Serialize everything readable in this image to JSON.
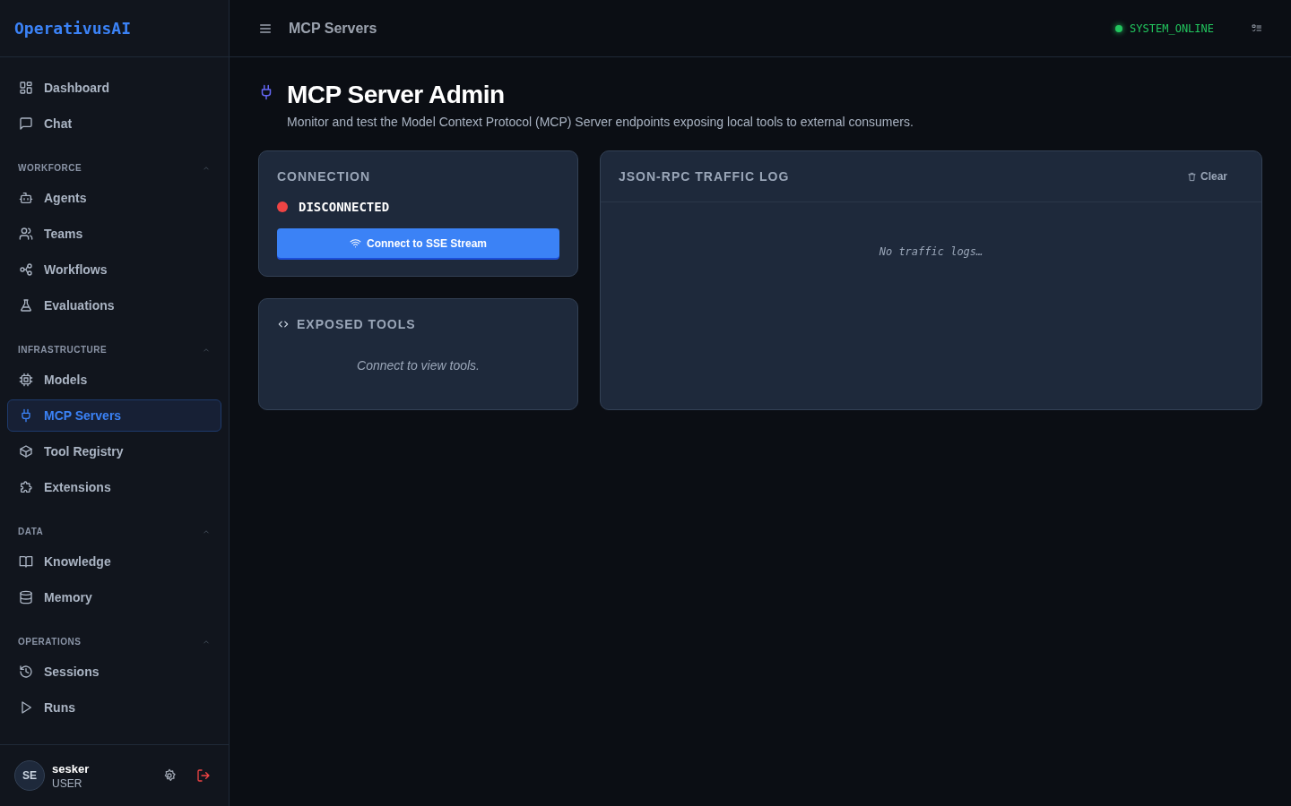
{
  "sidebar": {
    "logo": "OperativusAI",
    "top_items": [
      {
        "label": "Dashboard",
        "selected": false
      },
      {
        "label": "Chat",
        "selected": false
      }
    ],
    "sections": [
      {
        "title": "WORKFORCE",
        "expanded": true,
        "items": [
          {
            "label": "Agents",
            "selected": false
          },
          {
            "label": "Teams",
            "selected": false
          },
          {
            "label": "Workflows",
            "selected": false
          },
          {
            "label": "Evaluations",
            "selected": false
          }
        ]
      },
      {
        "title": "INFRASTRUCTURE",
        "expanded": true,
        "items": [
          {
            "label": "Models",
            "selected": false
          },
          {
            "label": "MCP Servers",
            "selected": true
          },
          {
            "label": "Tool Registry",
            "selected": false
          },
          {
            "label": "Extensions",
            "selected": false
          }
        ]
      },
      {
        "title": "DATA",
        "expanded": true,
        "items": [
          {
            "label": "Knowledge",
            "selected": false
          },
          {
            "label": "Memory",
            "selected": false
          }
        ]
      },
      {
        "title": "OPERATIONS",
        "expanded": true,
        "items": [
          {
            "label": "Sessions",
            "selected": false
          },
          {
            "label": "Runs",
            "selected": false
          }
        ]
      }
    ],
    "user": {
      "initials": "SE",
      "name": "sesker",
      "role": "USER"
    }
  },
  "header": {
    "title": "MCP Servers",
    "status": "SYSTEM_ONLINE"
  },
  "page": {
    "title": "MCP Server Admin",
    "subtitle": "Monitor and test the Model Context Protocol (MCP) Server endpoints exposing local tools to external consumers."
  },
  "connection": {
    "title": "CONNECTION",
    "status": "DISCONNECTED",
    "connected": false,
    "button": "Connect to SSE Stream"
  },
  "tools": {
    "title": "EXPOSED TOOLS",
    "empty": "Connect to view tools."
  },
  "log": {
    "title": "JSON-RPC TRAFFIC LOG",
    "clear": "Clear",
    "empty": "No traffic logs…"
  }
}
